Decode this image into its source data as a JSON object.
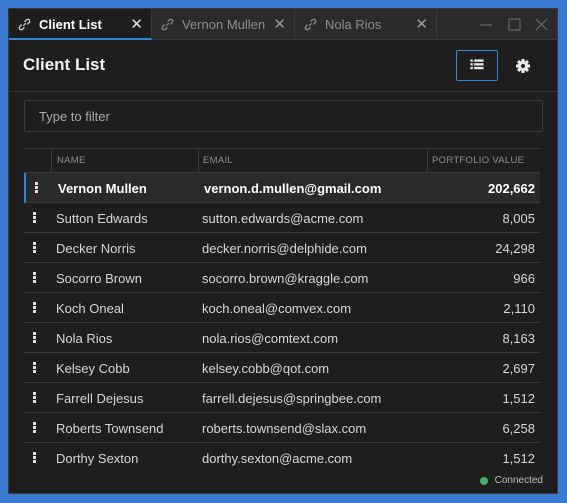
{
  "tabs": [
    {
      "label": "Client List",
      "active": true
    },
    {
      "label": "Vernon Mullen",
      "active": false
    },
    {
      "label": "Nola Rios",
      "active": false
    }
  ],
  "window_controls": {
    "minimize": "—",
    "maximize": "☐",
    "close": "✕"
  },
  "header": {
    "title": "Client List",
    "list_view_icon": "list-icon",
    "settings_icon": "gear-icon"
  },
  "filter": {
    "placeholder": "Type to filter",
    "value": ""
  },
  "table": {
    "columns": {
      "name": "NAME",
      "email": "EMAIL",
      "portfolio": "PORTFOLIO VALUE"
    },
    "rows": [
      {
        "name": "Vernon Mullen",
        "email": "vernon.d.mullen@gmail.com",
        "value": "202,662",
        "selected": true
      },
      {
        "name": "Sutton Edwards",
        "email": "sutton.edwards@acme.com",
        "value": "8,005"
      },
      {
        "name": "Decker Norris",
        "email": "decker.norris@delphide.com",
        "value": "24,298"
      },
      {
        "name": "Socorro Brown",
        "email": "socorro.brown@kraggle.com",
        "value": "966"
      },
      {
        "name": "Koch Oneal",
        "email": "koch.oneal@comvex.com",
        "value": "2,110"
      },
      {
        "name": "Nola Rios",
        "email": "nola.rios@comtext.com",
        "value": "8,163"
      },
      {
        "name": "Kelsey Cobb",
        "email": "kelsey.cobb@qot.com",
        "value": "2,697"
      },
      {
        "name": "Farrell Dejesus",
        "email": "farrell.dejesus@springbee.com",
        "value": "1,512"
      },
      {
        "name": "Roberts Townsend",
        "email": "roberts.townsend@slax.com",
        "value": "6,258"
      },
      {
        "name": "Dorthy Sexton",
        "email": "dorthy.sexton@acme.com",
        "value": "1,512"
      }
    ]
  },
  "status": {
    "text": "Connected",
    "color": "#3bb36a"
  },
  "colors": {
    "accent": "#2f86d8",
    "background": "#1e1e1e",
    "desktop": "#3a7ad0"
  }
}
